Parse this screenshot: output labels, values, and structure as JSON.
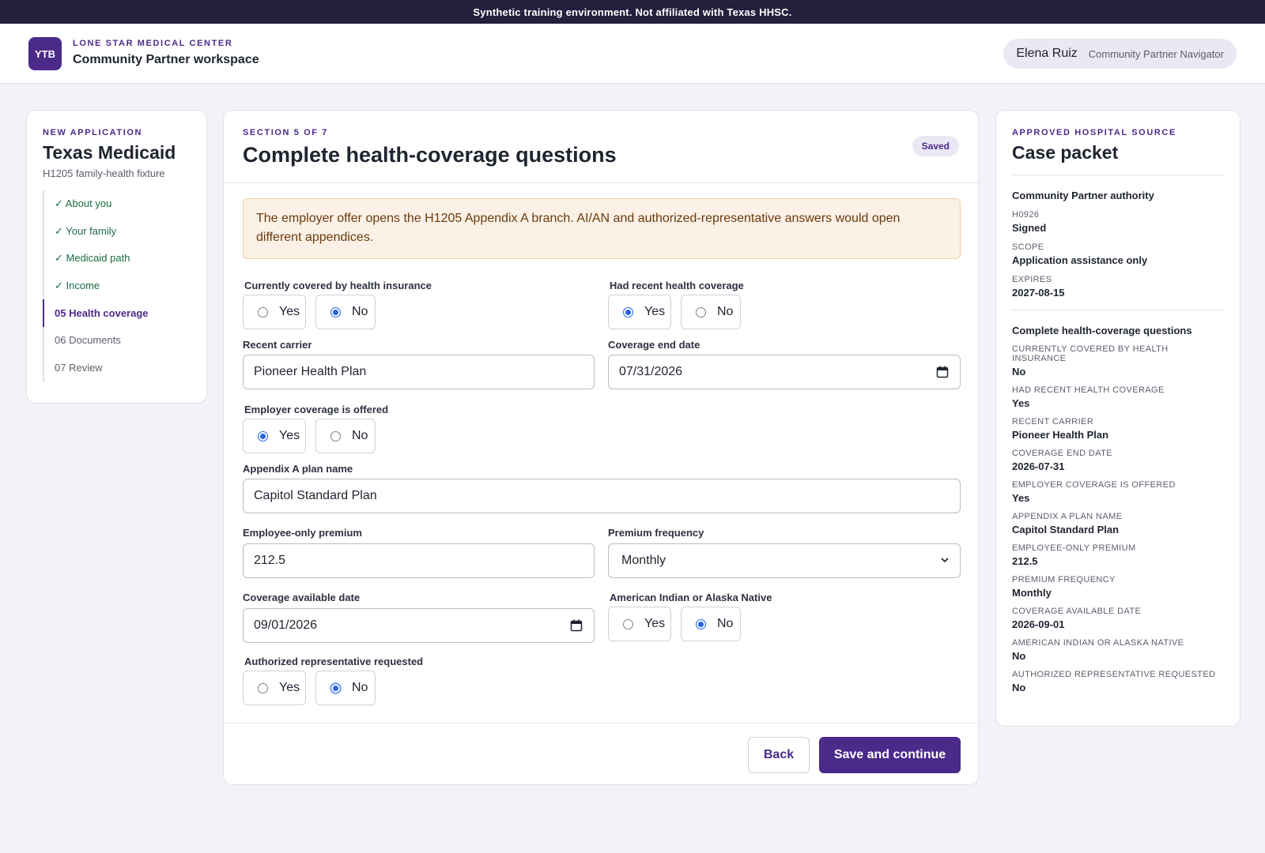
{
  "banner": "Synthetic training environment. Not affiliated with Texas HHSC.",
  "header": {
    "logo_text": "YTB",
    "org_name": "LONE STAR MEDICAL CENTER",
    "workspace": "Community Partner workspace",
    "user_name": "Elena Ruiz",
    "user_role": "Community Partner Navigator"
  },
  "nav": {
    "eyebrow": "NEW APPLICATION",
    "title": "Texas Medicaid",
    "subtitle": "H1205 family-health fixture",
    "steps": [
      {
        "label": "✓ About you",
        "state": "done"
      },
      {
        "label": "✓ Your family",
        "state": "done"
      },
      {
        "label": "✓ Medicaid path",
        "state": "done"
      },
      {
        "label": "✓ Income",
        "state": "done"
      },
      {
        "label": "05 Health coverage",
        "state": "current"
      },
      {
        "label": "06 Documents",
        "state": "todo"
      },
      {
        "label": "07 Review",
        "state": "todo"
      }
    ]
  },
  "main": {
    "eyebrow": "SECTION 5 OF 7",
    "title": "Complete health-coverage questions",
    "saved_badge": "Saved",
    "alert": "The employer offer opens the H1205 Appendix A branch. AI/AN and authorized-representative answers would open different appendices.",
    "yes": "Yes",
    "no": "No",
    "fields": {
      "currently_covered": {
        "label": "Currently covered by health insurance",
        "value": "No"
      },
      "recent_coverage": {
        "label": "Had recent health coverage",
        "value": "Yes"
      },
      "recent_carrier": {
        "label": "Recent carrier",
        "value": "Pioneer Health Plan"
      },
      "coverage_end_date": {
        "label": "Coverage end date",
        "value": "07/31/2026"
      },
      "employer_offered": {
        "label": "Employer coverage is offered",
        "value": "Yes"
      },
      "plan_name": {
        "label": "Appendix A plan name",
        "value": "Capitol Standard Plan"
      },
      "premium": {
        "label": "Employee-only premium",
        "value": "212.5"
      },
      "premium_frequency": {
        "label": "Premium frequency",
        "value": "Monthly"
      },
      "coverage_available_date": {
        "label": "Coverage available date",
        "value": "09/01/2026"
      },
      "aian": {
        "label": "American Indian or Alaska Native",
        "value": "No"
      },
      "authorized_rep": {
        "label": "Authorized representative requested",
        "value": "No"
      }
    },
    "back_label": "Back",
    "save_label": "Save and continue"
  },
  "packet": {
    "eyebrow": "APPROVED HOSPITAL SOURCE",
    "title": "Case packet",
    "authority_title": "Community Partner authority",
    "authority": [
      {
        "key": "H0926",
        "value": "Signed"
      },
      {
        "key": "SCOPE",
        "value": "Application assistance only"
      },
      {
        "key": "EXPIRES",
        "value": "2027-08-15"
      }
    ],
    "answers_title": "Complete health-coverage questions",
    "answers": [
      {
        "key": "CURRENTLY COVERED BY HEALTH INSURANCE",
        "value": "No"
      },
      {
        "key": "HAD RECENT HEALTH COVERAGE",
        "value": "Yes"
      },
      {
        "key": "RECENT CARRIER",
        "value": "Pioneer Health Plan"
      },
      {
        "key": "COVERAGE END DATE",
        "value": "2026-07-31"
      },
      {
        "key": "EMPLOYER COVERAGE IS OFFERED",
        "value": "Yes"
      },
      {
        "key": "APPENDIX A PLAN NAME",
        "value": "Capitol Standard Plan"
      },
      {
        "key": "EMPLOYEE-ONLY PREMIUM",
        "value": "212.5"
      },
      {
        "key": "PREMIUM FREQUENCY",
        "value": "Monthly"
      },
      {
        "key": "COVERAGE AVAILABLE DATE",
        "value": "2026-09-01"
      },
      {
        "key": "AMERICAN INDIAN OR ALASKA NATIVE",
        "value": "No"
      },
      {
        "key": "AUTHORIZED REPRESENTATIVE REQUESTED",
        "value": "No"
      }
    ]
  },
  "colors": {
    "brand": "#4b2a8a",
    "banner_bg": "#231f3d",
    "done_green": "#1d6b45",
    "radio_blue": "#2563eb",
    "alert_bg": "#fbf1e6"
  }
}
